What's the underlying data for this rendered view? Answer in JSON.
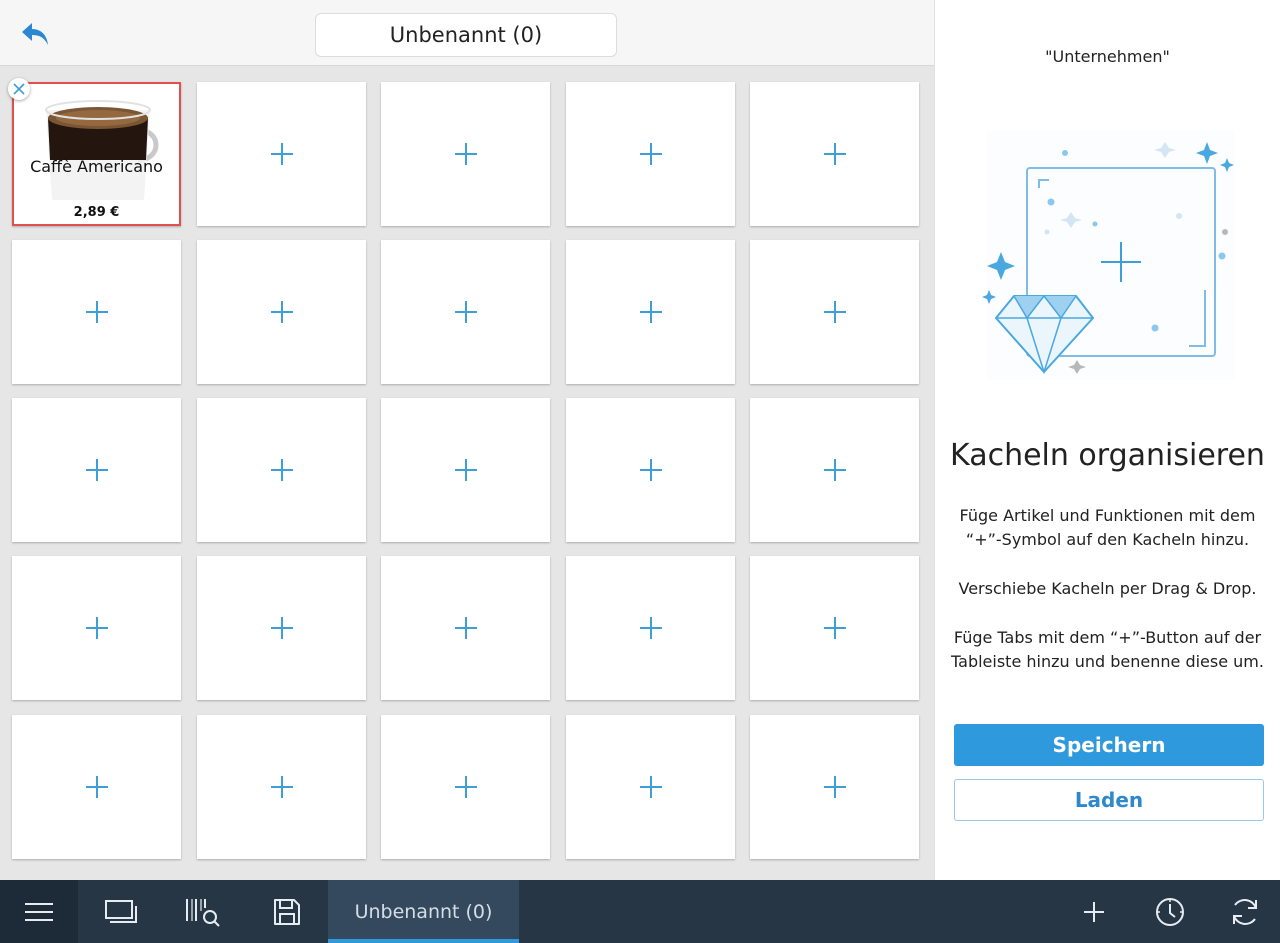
{
  "header": {
    "title": "Unbenannt (0)",
    "back_icon": "reply-arrow-icon"
  },
  "grid": {
    "columns": 5,
    "rows": 5,
    "product_tile": {
      "name": "Caffè Americano",
      "price": "2,89 €",
      "image": "coffee-mug-image"
    },
    "empty_tile_icon": "plus-icon"
  },
  "panel": {
    "company": "\"Unternehmen\"",
    "heading": "Kacheln organisieren",
    "paragraph1": "Füge Artikel und Funktionen mit dem “+”-Symbol auf den Kacheln hinzu.",
    "paragraph2": "Verschiebe Kacheln per Drag & Drop.",
    "paragraph3": "Füge Tabs mit dem “+”-Button auf der Tableiste hinzu und benenne diese um.",
    "save_label": "Speichern",
    "load_label": "Laden"
  },
  "bottombar": {
    "active_tab_label": "Unbenannt (0)",
    "icons": [
      "menu-icon",
      "screens-icon",
      "barcode-search-icon",
      "save-icon",
      "add-icon",
      "clock-icon",
      "sync-icon"
    ]
  },
  "colors": {
    "accent": "#2e99dd",
    "selected_border": "#e05050",
    "bottombar": "#263645"
  }
}
